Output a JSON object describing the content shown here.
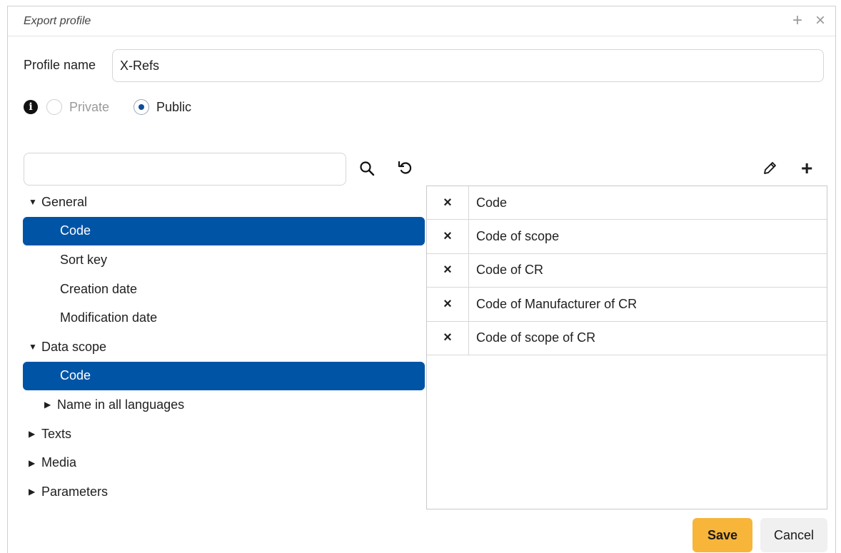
{
  "window": {
    "title": "Export profile",
    "add_glyph": "+",
    "close_glyph": "×"
  },
  "profile": {
    "label": "Profile name",
    "value": "X-Refs"
  },
  "visibility": {
    "private_label": "Private",
    "public_label": "Public",
    "selected": "Public"
  },
  "search": {
    "placeholder": "",
    "value": ""
  },
  "tree": {
    "general": "General",
    "general_code": "Code",
    "sort_key": "Sort key",
    "creation_date": "Creation date",
    "modification_date": "Modification date",
    "data_scope": "Data scope",
    "data_scope_code": "Code",
    "name_all_languages": "Name in all languages",
    "texts": "Texts",
    "media": "Media",
    "parameters": "Parameters"
  },
  "selected_columns": [
    "Code",
    "Code of scope",
    "Code of CR",
    "Code of Manufacturer of CR",
    "Code of scope of CR"
  ],
  "remove_glyph": "×",
  "actions": {
    "save": "Save",
    "cancel": "Cancel"
  },
  "colors": {
    "selection": "#0054a6",
    "save_button": "#f7b53a",
    "radio_selected": "#0f4c99"
  }
}
